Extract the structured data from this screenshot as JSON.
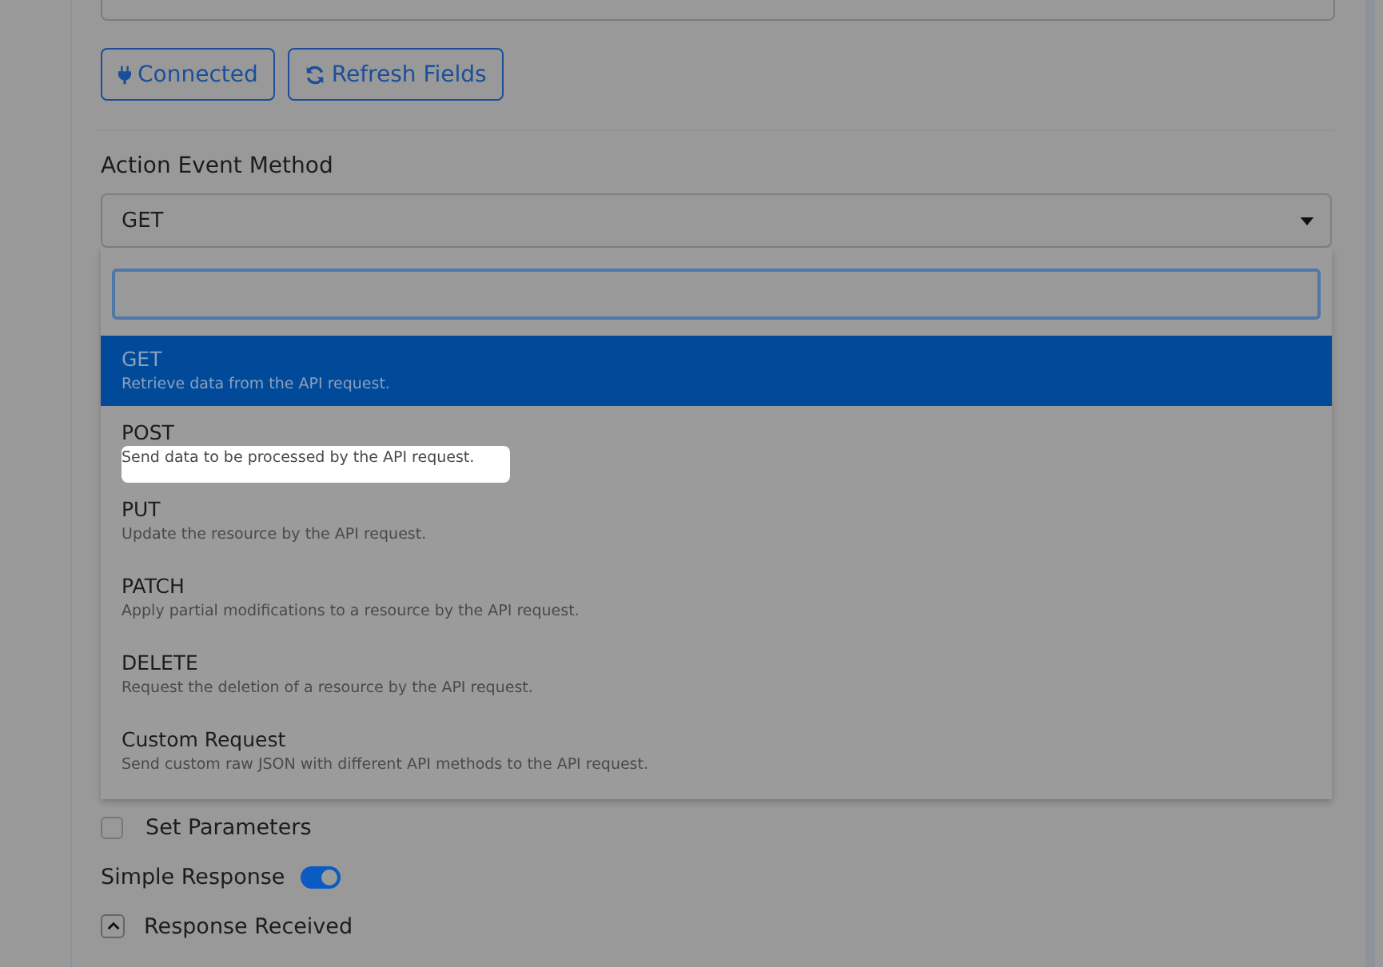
{
  "connection_buttons": [
    {
      "kind": "plug",
      "label": "Connected"
    },
    {
      "kind": "refresh",
      "label": "Refresh Fields"
    }
  ],
  "method_field": {
    "label": "Action Event Method",
    "value": "GET",
    "expanded": true
  },
  "dropdown": {
    "options": [
      {
        "name": "GET",
        "description": "Retrieve data from the API request.",
        "selected": true,
        "highlighted": false
      },
      {
        "name": "POST",
        "description": "Send data to be processed by the API request.",
        "selected": false,
        "highlighted": true
      },
      {
        "name": "PUT",
        "description": "Update the resource by the API request.",
        "selected": false,
        "highlighted": false
      },
      {
        "name": "PATCH",
        "description": "Apply partial modifications to a resource by the API request.",
        "selected": false,
        "highlighted": false
      },
      {
        "name": "DELETE",
        "description": "Request the deletion of a resource by the API request.",
        "selected": false,
        "highlighted": false
      },
      {
        "name": "Custom Request",
        "description": "Send custom raw JSON with different API methods to the API request.",
        "selected": false,
        "highlighted": false
      }
    ]
  },
  "set_parameters": {
    "label": "Set Parameters",
    "checked": false
  },
  "simple_response": {
    "label": "Simple Response",
    "on": true
  },
  "response_received": {
    "label": "Response Received",
    "expanded": true
  }
}
